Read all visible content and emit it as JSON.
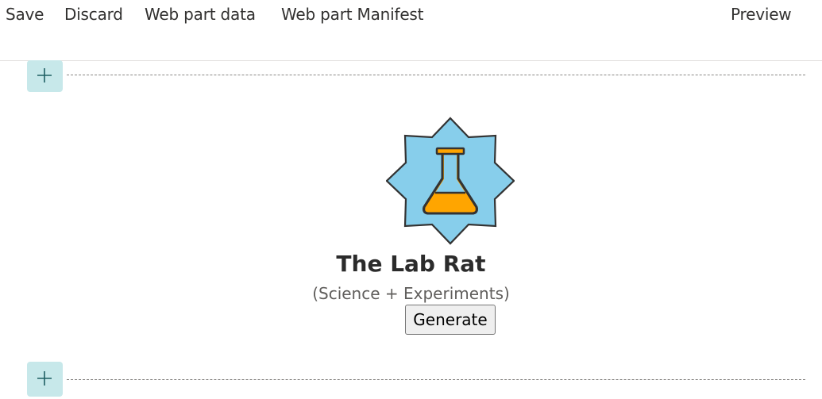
{
  "toolbar": {
    "save_label": "Save",
    "discard_label": "Discard",
    "web_part_data_label": "Web part data",
    "web_part_manifest_label": "Web part Manifest",
    "preview_label": "Preview"
  },
  "canvas": {
    "add_section_icon": "plus-icon"
  },
  "webpart": {
    "logo_icon": "flask-star-icon",
    "title": "The Lab Rat",
    "subtitle": "(Science + Experiments)",
    "generate_label": "Generate",
    "colors": {
      "star_fill": "#87ceeb",
      "flask_liquid": "#ffa500",
      "outline": "#333333",
      "add_button_bg": "#c7e8ea"
    }
  }
}
